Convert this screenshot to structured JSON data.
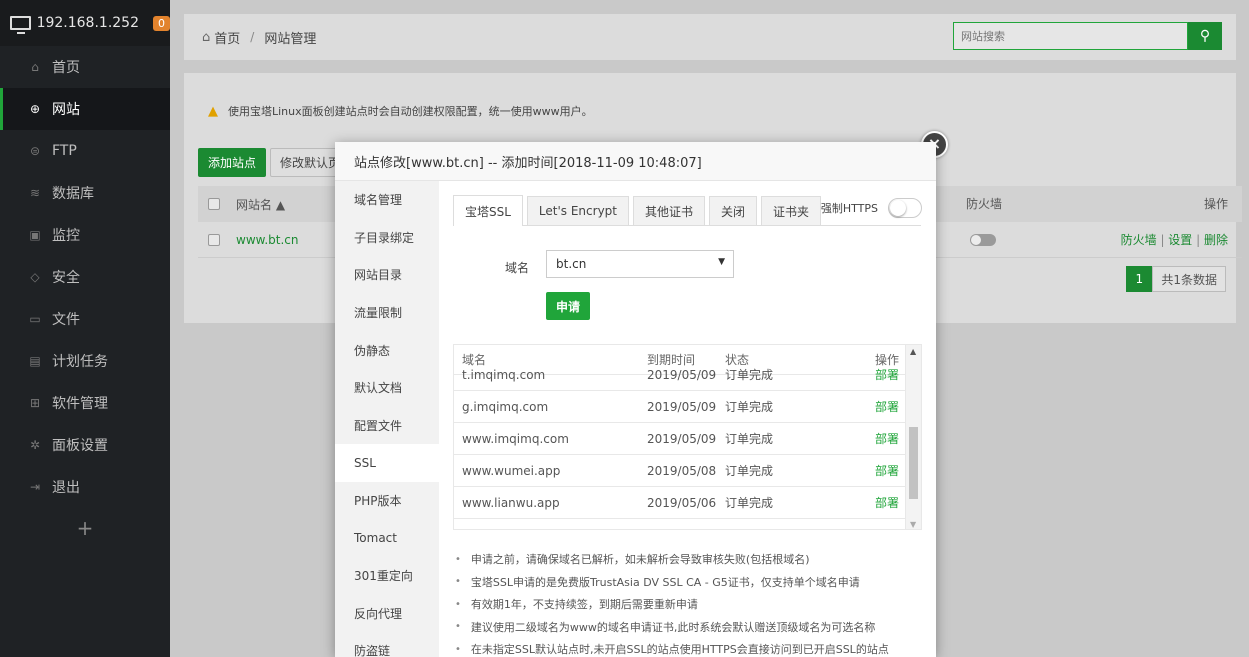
{
  "sidebar": {
    "ip": "192.168.1.252",
    "badge": "0",
    "items": [
      {
        "label": "首页",
        "icon": "home-icon"
      },
      {
        "label": "网站",
        "icon": "globe-icon"
      },
      {
        "label": "FTP",
        "icon": "ftp-icon"
      },
      {
        "label": "数据库",
        "icon": "database-icon"
      },
      {
        "label": "监控",
        "icon": "monitor-icon"
      },
      {
        "label": "安全",
        "icon": "shield-icon"
      },
      {
        "label": "文件",
        "icon": "folder-icon"
      },
      {
        "label": "计划任务",
        "icon": "calendar-icon"
      },
      {
        "label": "软件管理",
        "icon": "apps-icon"
      },
      {
        "label": "面板设置",
        "icon": "gear-icon"
      },
      {
        "label": "退出",
        "icon": "logout-icon"
      }
    ],
    "add": "+"
  },
  "topbar": {
    "home": "首页",
    "sep": "/",
    "crumb": "网站管理",
    "search_placeholder": "网站搜索"
  },
  "page": {
    "warning": "使用宝塔Linux面板创建站点时会自动创建权限配置，统一使用www用户。",
    "add_site": "添加站点",
    "modify_default": "修改默认页",
    "col_site": "网站名 ▲",
    "col_firewall": "防火墙",
    "col_ops": "操作",
    "row_site": "www.bt.cn",
    "ops": {
      "fw": "防火墙",
      "bar": " | ",
      "settings": "设置",
      "delete": "删除"
    },
    "pager_page": "1",
    "pager_total": "共1条数据"
  },
  "modal": {
    "title": "站点修改[www.bt.cn] -- 添加时间[2018-11-09 10:48:07]",
    "close": "×",
    "menu": [
      "域名管理",
      "子目录绑定",
      "网站目录",
      "流量限制",
      "伪静态",
      "默认文档",
      "配置文件",
      "SSL",
      "PHP版本",
      "Tomact",
      "301重定向",
      "反向代理",
      "防盗链"
    ],
    "active_menu": "SSL",
    "tabs": [
      "宝塔SSL",
      "Let's Encrypt",
      "其他证书",
      "关闭",
      "证书夹"
    ],
    "force_https": "强制HTTPS",
    "force_https_on": false,
    "domain_label": "域名",
    "domain_value": "bt.cn",
    "apply": "申请",
    "cert_headers": [
      "域名",
      "到期时间",
      "状态",
      "操作"
    ],
    "certs": [
      {
        "domain": "t.imqimq.com",
        "expire": "2019/05/09",
        "status": "订单完成",
        "op": "部署"
      },
      {
        "domain": "g.imqimq.com",
        "expire": "2019/05/09",
        "status": "订单完成",
        "op": "部署"
      },
      {
        "domain": "www.imqimq.com",
        "expire": "2019/05/09",
        "status": "订单完成",
        "op": "部署"
      },
      {
        "domain": "www.wumei.app",
        "expire": "2019/05/08",
        "status": "订单完成",
        "op": "部署"
      },
      {
        "domain": "www.lianwu.app",
        "expire": "2019/05/06",
        "status": "订单完成",
        "op": "部署"
      }
    ],
    "notes": [
      "申请之前，请确保域名已解析，如未解析会导致审核失败(包括根域名)",
      "宝塔SSL申请的是免费版TrustAsia DV SSL CA - G5证书，仅支持单个域名申请",
      "有效期1年，不支持续签，到期后需要重新申请",
      "建议使用二级域名为www的域名申请证书,此时系统会默认赠送顶级域名为可选名称",
      "在未指定SSL默认站点时,未开启SSL的站点使用HTTPS会直接访问到已开启SSL的站点"
    ]
  },
  "colors": {
    "accent": "#20a53a",
    "sidebar_bg": "#1f2225",
    "badge": "#e2832d"
  }
}
